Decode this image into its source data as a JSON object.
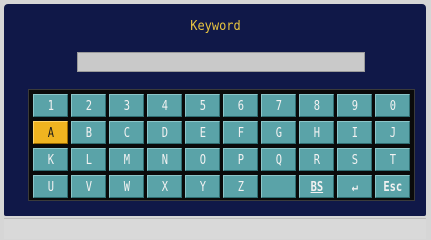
{
  "dialog": {
    "title": "Keyword",
    "input_value": ""
  },
  "keyboard": {
    "selected_key": "A",
    "rows": [
      [
        "1",
        "2",
        "3",
        "4",
        "5",
        "6",
        "7",
        "8",
        "9",
        "0"
      ],
      [
        "A",
        "B",
        "C",
        "D",
        "E",
        "F",
        "G",
        "H",
        "I",
        "J"
      ],
      [
        "K",
        "L",
        "M",
        "N",
        "O",
        "P",
        "Q",
        "R",
        "S",
        "T"
      ],
      [
        "U",
        "V",
        "W",
        "X",
        "Y",
        "Z",
        "",
        "BS",
        "↵",
        "Esc"
      ]
    ]
  },
  "colors": {
    "panel_background": "#101848",
    "key_background": "#5aa3a8",
    "selected_key": "#f0b420",
    "title_text": "#e8c440"
  }
}
